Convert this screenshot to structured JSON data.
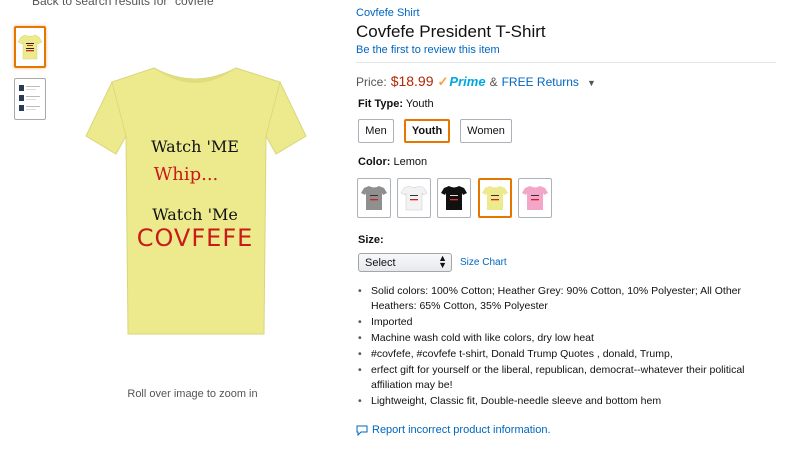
{
  "top": {
    "back_link": "Back to search results for \"covfefe\""
  },
  "gallery": {
    "zoom_hint": "Roll over image to zoom in",
    "shirt_color": "#ecea8d",
    "print_lines": [
      "Watch 'ME",
      "Whip...",
      "Watch 'Me",
      "COVFEFE"
    ]
  },
  "product": {
    "brand": "Covfefe Shirt",
    "title": "Covfefe President T-Shirt",
    "review_link": "Be the first to review this item",
    "price_label": "Price:",
    "price_value": "$18.99",
    "prime_label": "Prime",
    "amp": "&",
    "free_returns": "FREE Returns",
    "fit_type_label": "Fit Type:",
    "fit_type_value": "Youth",
    "fit_options": [
      "Men",
      "Youth",
      "Women"
    ],
    "color_label": "Color:",
    "color_value": "Lemon",
    "colors": [
      {
        "name": "Heather Grey",
        "hex": "#8f8f8f"
      },
      {
        "name": "White",
        "hex": "#f2f2f2"
      },
      {
        "name": "Black",
        "hex": "#111111"
      },
      {
        "name": "Lemon",
        "hex": "#ecea8d"
      },
      {
        "name": "Pink",
        "hex": "#f3a6c8"
      }
    ],
    "size_label": "Size:",
    "size_select_value": "Select",
    "size_chart": "Size Chart",
    "bullets": [
      "Solid colors: 100% Cotton; Heather Grey: 90% Cotton, 10% Polyester; All Other Heathers: 65% Cotton, 35% Polyester",
      "Imported",
      "Machine wash cold with like colors, dry low heat",
      "#covfefe, #covfefe t-shirt, Donald Trump Quotes , donald, Trump,",
      "erfect gift for yourself or the liberal, republican, democrat--whatever their political affiliation may be!",
      "Lightweight, Classic fit, Double-needle sleeve and bottom hem"
    ],
    "report_link": "Report incorrect product information."
  }
}
